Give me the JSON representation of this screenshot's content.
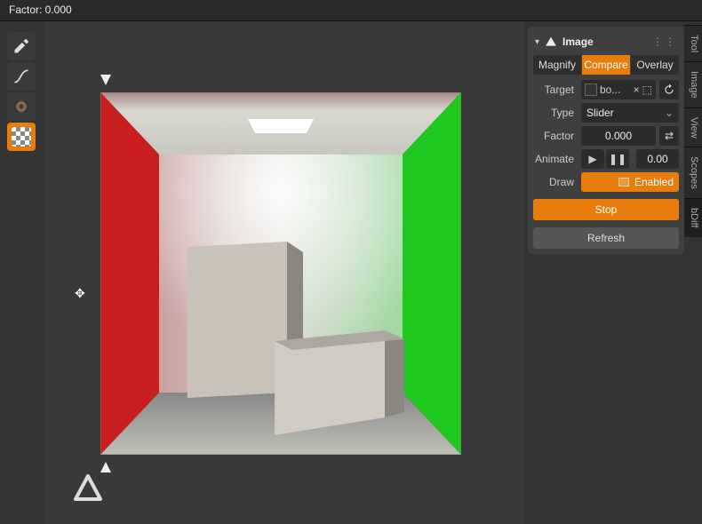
{
  "topbar": {
    "factor_label": "Factor: 0.000"
  },
  "side_tabs": [
    "Tool",
    "Image",
    "View",
    "Scopes",
    "bDiff"
  ],
  "panel": {
    "title": "Image",
    "tabs": {
      "magnify": "Magnify",
      "compare": "Compare",
      "overlay": "Overlay",
      "active": "compare"
    },
    "target": {
      "label": "Target",
      "value": "bo..."
    },
    "type": {
      "label": "Type",
      "value": "Slider"
    },
    "factor": {
      "label": "Factor",
      "value": "0.000"
    },
    "animate": {
      "label": "Animate",
      "value": "0.00"
    },
    "draw": {
      "label": "Draw",
      "value": "Enabled"
    },
    "stop": "Stop",
    "refresh": "Refresh"
  }
}
